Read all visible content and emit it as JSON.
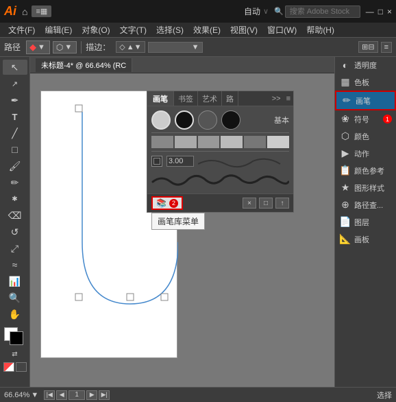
{
  "titleBar": {
    "logo": "Ai",
    "autoLabel": "自动",
    "searchPlaceholder": "搜索 Adobe Stock",
    "windowButtons": [
      "—",
      "□",
      "×"
    ]
  },
  "menuBar": {
    "items": [
      "文件(F)",
      "编辑(E)",
      "对象(O)",
      "文字(T)",
      "选择(S)",
      "效果(E)",
      "视图(V)",
      "窗口(W)",
      "帮助(H)"
    ]
  },
  "toolbar": {
    "pathLabel": "路径",
    "strokeLabel": "描边：",
    "strokeValue": "♦"
  },
  "tabBar": {
    "title": "未标题-4* @ 66.64% (RC",
    "tabs": [
      "画笔",
      "书签 艺术",
      "路"
    ]
  },
  "brushPanel": {
    "tabs": [
      "画笔",
      "书签",
      "艺术",
      "路径"
    ],
    "activeTab": "画笔",
    "basicLabel": "基本",
    "sizeValue": "3.00",
    "footerButtons": [
      "×",
      "□",
      "↑"
    ],
    "libButtonLabel": "画笔库菜单",
    "badge": "2"
  },
  "rightPanel": {
    "items": [
      {
        "label": "透明度",
        "icon": "◐"
      },
      {
        "label": "色板",
        "icon": "▦"
      },
      {
        "label": "画笔",
        "icon": "✏",
        "active": true
      },
      {
        "label": "符号",
        "icon": "✿",
        "badge": "1"
      },
      {
        "label": "颜色",
        "icon": "⬡"
      },
      {
        "label": "动作",
        "icon": "▶"
      },
      {
        "label": "颜色参考",
        "icon": "📋"
      },
      {
        "label": "图形样式",
        "icon": "★"
      },
      {
        "label": "路径查...",
        "icon": "⊕"
      },
      {
        "label": "图层",
        "icon": "📄"
      },
      {
        "label": "画板",
        "icon": "📐"
      }
    ]
  },
  "statusBar": {
    "zoom": "66.64%",
    "page": "1",
    "mode": "选择"
  }
}
